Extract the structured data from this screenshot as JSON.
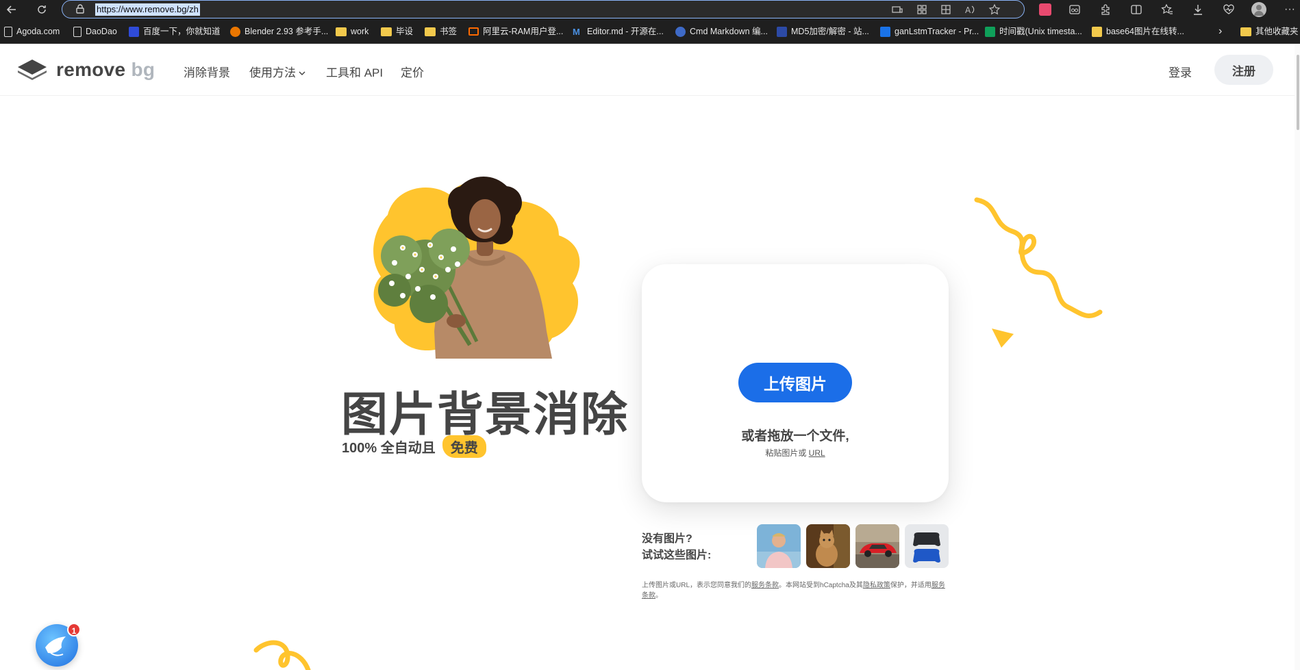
{
  "browser": {
    "url": "https://www.remove.bg/zh",
    "bookmarks": [
      "Agoda.com",
      "DaoDao",
      "百度一下，你就知道",
      "Blender 2.93 参考手...",
      "work",
      "毕设",
      "书签",
      "阿里云-RAM用户登...",
      "Editor.md - 开源在...",
      "Cmd Markdown 编...",
      "MD5加密/解密 - 站...",
      "ganLstmTracker - Pr...",
      "时间戳(Unix timesta...",
      "base64图片在线转...",
      "其他收藏夹"
    ],
    "more_bookmarks": "›"
  },
  "site": {
    "logo_main": "remove",
    "logo_bg": "bg",
    "nav": [
      "消除背景",
      "使用方法",
      "工具和 API",
      "定价"
    ],
    "login": "登录",
    "signup": "注册"
  },
  "hero": {
    "title": "图片背景消除",
    "subtitle": "100% 全自动且",
    "free_badge": "免费"
  },
  "upload": {
    "button": "上传图片",
    "drop_text": "或者拖放一个文件,",
    "paste_prefix": "粘贴图片或 ",
    "paste_link": "URL"
  },
  "samples": {
    "line1": "没有图片?",
    "line2": "试试这些图片:",
    "items": [
      "person",
      "cat",
      "car",
      "gamepads"
    ]
  },
  "legal": {
    "p1": "上传图片或URL，表示您同意我们的",
    "tos": "服务条款",
    "p2": "。本网站受到hCaptcha及其",
    "privacy": "隐私政策",
    "p3": "保护，并适用",
    "tos2": "服务条款",
    "p4": "。"
  },
  "notification": {
    "count": "1"
  },
  "colors": {
    "accent": "#1b6ee8",
    "yellow": "#ffc42e",
    "text": "#454545"
  }
}
